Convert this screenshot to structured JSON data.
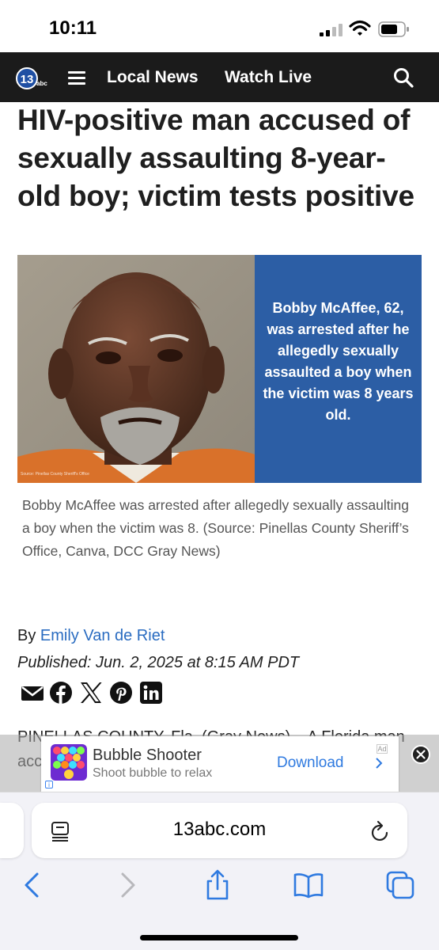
{
  "status": {
    "time": "10:11"
  },
  "nav": {
    "local_news": "Local News",
    "watch_live": "Watch Live"
  },
  "article": {
    "headline": "HIV-positive man accused of sexually assaulting 8-year-old boy; victim tests positive",
    "image_panel_text": "Bobby McAffee, 62, was arrested after he allegedly sexually assaulted a boy when the victim was 8 years old.",
    "photo_credit": "Source: Pinellas County Sheriff's Office",
    "caption": "Bobby McAffee was arrested after allegedly sexually assaulting a boy when the victim was 8. (Source: Pinellas County Sheriff’s Office, Canva, DCC Gray News)",
    "byline_prefix": "By",
    "author": "Emily Van de Riet",
    "published": "Published: Jun. 2, 2025 at 8:15 AM PDT",
    "body": "PINELLAS COUNTY, Fla. (Gray News) – A Florida man accused a boy and gave him HIV"
  },
  "ad": {
    "title": "Bubble Shooter",
    "subtitle": "Shoot bubble to relax",
    "cta": "Download",
    "badge": "Ad"
  },
  "browser": {
    "url": "13abc.com"
  },
  "colors": {
    "nav_bg": "#1b1b1b",
    "panel_blue": "#2c5ea5",
    "link_blue": "#2a6cc1"
  }
}
